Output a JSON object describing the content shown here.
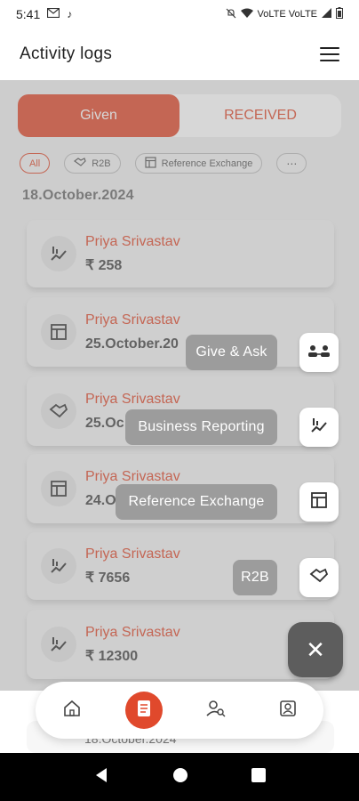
{
  "status_bar": {
    "time": "5:41",
    "left_icons": [
      "gmail-icon",
      "tiktok-icon"
    ],
    "right_text": "VoLTE  VoLTE"
  },
  "header": {
    "title": "Activity logs"
  },
  "segments": [
    {
      "label": "Given",
      "active": true
    },
    {
      "label": "RECEIVED",
      "active": false
    }
  ],
  "filters": [
    {
      "label": "All",
      "icon": ""
    },
    {
      "label": "R2B",
      "icon": "handshake-icon"
    },
    {
      "label": "Reference Exchange",
      "icon": "table-icon"
    }
  ],
  "date_header": "18.October.2024",
  "cards": [
    {
      "name": "Priya Srivastav",
      "sub": "₹ 258",
      "icon": "chart-icon"
    },
    {
      "name": "Priya Srivastav",
      "sub": "25.October.20",
      "icon": "table-icon"
    },
    {
      "name": "Priya Srivastav",
      "sub": "25.Oc",
      "icon": "handshake-icon"
    },
    {
      "name": "Priya Srivastav",
      "sub": "24.O",
      "icon": "table-icon"
    },
    {
      "name": "Priya Srivastav",
      "sub": "₹ 7656",
      "icon": "chart-icon"
    },
    {
      "name": "Priya Srivastav",
      "sub": "₹ 12300",
      "icon": "chart-icon"
    }
  ],
  "bottom_peek": "18.October.2024",
  "speed_dial": [
    {
      "label": "Give & Ask",
      "icon": "people-icon"
    },
    {
      "label": "Business Reporting",
      "icon": "chart-icon"
    },
    {
      "label": "Reference Exchange",
      "icon": "table-icon"
    },
    {
      "label": "R2B",
      "icon": "handshake-icon"
    }
  ],
  "fab_close": "✕",
  "bottom_nav": [
    {
      "name": "home",
      "icon": "home-icon",
      "active": false
    },
    {
      "name": "activity",
      "icon": "document-icon",
      "active": true
    },
    {
      "name": "search-people",
      "icon": "people-search-icon",
      "active": false
    },
    {
      "name": "profile",
      "icon": "profile-icon",
      "active": false
    }
  ],
  "accent_color": "#e0492c"
}
